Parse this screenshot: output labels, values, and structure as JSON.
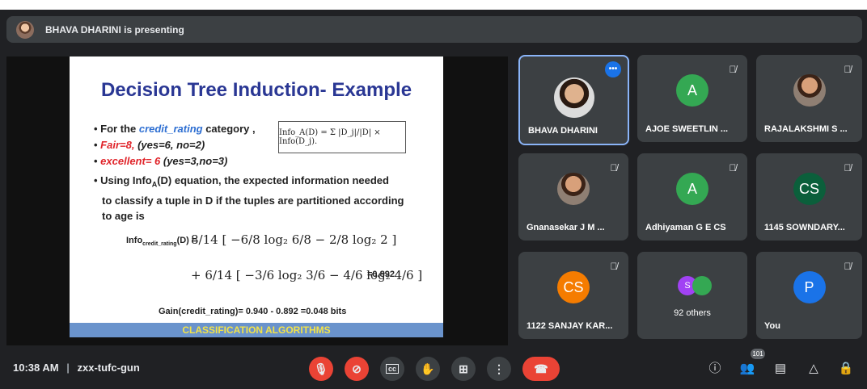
{
  "banner": {
    "text": "BHAVA DHARINI is presenting"
  },
  "slide": {
    "title": "Decision Tree Induction- Example",
    "bullet1_prefix": "For the ",
    "bullet1_em": "credit_rating",
    "bullet1_suffix": " category ,",
    "bullet2_a": "Fair=8,",
    "bullet2_b": " (yes=6, no=2)",
    "bullet3_a": "excellent= 6",
    "bullet3_b": " (yes=3,no=3)",
    "bullet4_line1": "Using Info",
    "bullet4_sub": "A",
    "bullet4_line1b": "(D) equation, the expected information needed",
    "bullet4_line2": "to classify a tuple in D if the tuples are partitioned according",
    "bullet4_line3": "to age is",
    "formula_box": "Info_A(D) = Σ |D_j|/|D| × Info(D_j).",
    "eq_label": "Info",
    "eq_sub": "credit_rating",
    "eq_label_end": "(D) =",
    "eq_row1": "8/14 [ −6/8 log₂ 6/8 − 2/8 log₂ 2 ]",
    "eq_row2": "+ 6/14 [ −3/6 log₂ 3/6 − 4/6 log₂ 4/6 ]",
    "eq_result": "=0.892",
    "gain": "Gain(credit_rating)= 0.940 - 0.892 =0.048 bits",
    "footer": "CLASSIFICATION ALGORITHMS"
  },
  "participants": [
    {
      "name": "BHAVA DHARINI",
      "avatar": "",
      "speaking": true
    },
    {
      "name": "AJOE SWEETLIN ...",
      "avatar": "A",
      "color": "#34a853"
    },
    {
      "name": "RAJALAKSHMI S ...",
      "avatar": ""
    },
    {
      "name": "Gnanasekar J M ...",
      "avatar": ""
    },
    {
      "name": "Adhiyaman G E CS",
      "avatar": "A",
      "color": "#34a853"
    },
    {
      "name": "1145 SOWNDARY...",
      "avatar": "CS",
      "color": "#0b5f3b"
    },
    {
      "name": "1122 SANJAY KAR...",
      "avatar": "CS",
      "color": "#f57c00"
    },
    {
      "name": "92 others",
      "avatar_a": "S",
      "avatar_a_color": "#a142f4"
    },
    {
      "name": "You",
      "avatar": "P",
      "color": "#1a73e8"
    }
  ],
  "bottom": {
    "time": "10:38 AM",
    "separator": "|",
    "meeting_code": "zxx-tufc-gun",
    "people_count": "101"
  },
  "icons": {
    "mic_off": "mic-off-icon",
    "cam_off": "camera-off-icon",
    "cc": "captions-icon",
    "hand": "raise-hand-icon",
    "present": "present-icon",
    "more": "more-icon",
    "end_call": "end-call-icon",
    "info": "info-icon",
    "people": "people-icon",
    "chat": "chat-icon",
    "activities": "activities-icon",
    "host": "host-controls-icon"
  }
}
